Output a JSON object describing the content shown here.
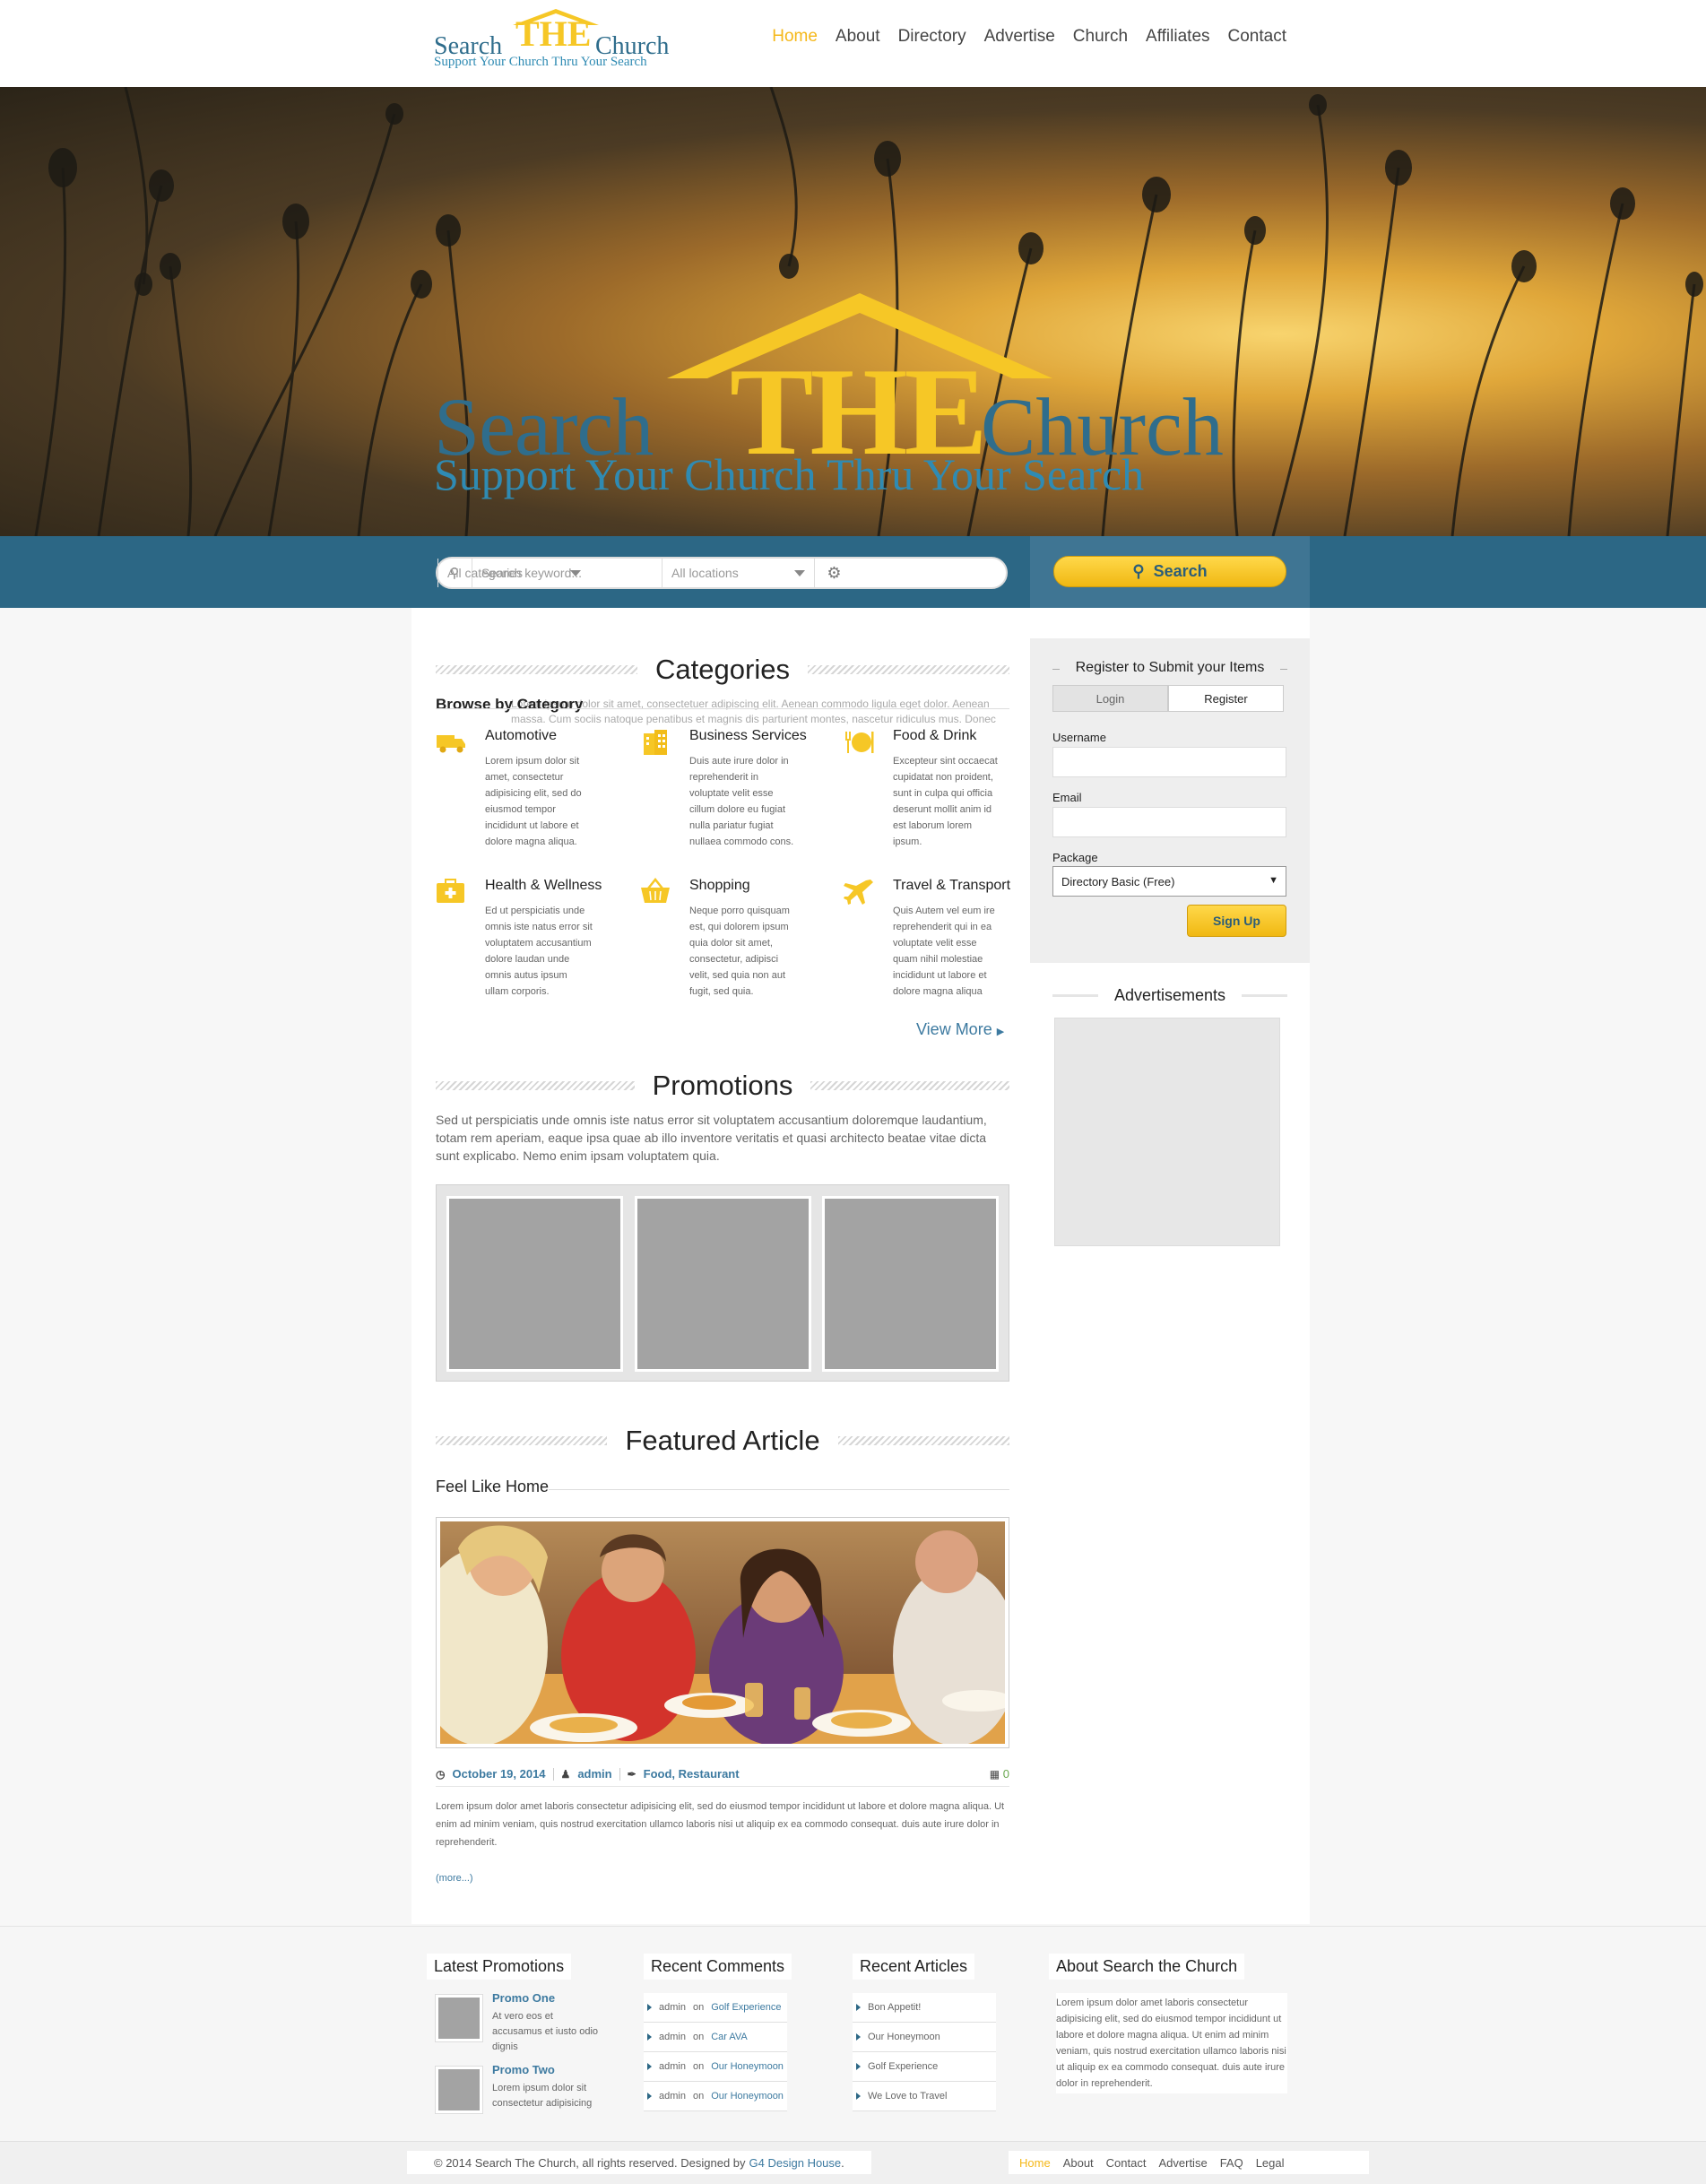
{
  "header": {
    "logo": {
      "search": "Search",
      "the": "THE",
      "church": "Church",
      "tagline": "Support Your Church Thru Your Search"
    },
    "nav": [
      "Home",
      "About",
      "Directory",
      "Advertise",
      "Church",
      "Affiliates",
      "Contact"
    ],
    "active_nav": "Home"
  },
  "hero": {
    "search": "Search",
    "the": "THE",
    "church": "Church",
    "tagline": "Support Your Church Thru Your Search"
  },
  "search": {
    "keyword_placeholder": "Search keyword...",
    "location": "All locations",
    "category": "All categories",
    "button": "Search"
  },
  "categories": {
    "title": "Categories",
    "browse": "Browse by Category",
    "ghost_text": "Lorem ipsum dolor sit amet, consectetuer adipiscing elit. Aenean commodo ligula eget dolor. Aenean massa. Cum sociis natoque penatibus et magnis dis parturient montes, nascetur ridiculus mus. Donec quam felis, ultricies nec.",
    "items": [
      {
        "name": "Automotive",
        "icon": "truck-icon",
        "desc": "Lorem ipsum dolor sit amet, consectetur adipisicing elit, sed do eiusmod tempor incididunt ut labore et dolore magna aliqua."
      },
      {
        "name": "Business Services",
        "icon": "building-icon",
        "desc": "Duis aute irure dolor in reprehenderit in voluptate velit esse cillum dolore eu fugiat nulla pariatur fugiat nullaea commodo cons."
      },
      {
        "name": "Food & Drink",
        "icon": "food-icon",
        "desc": "Excepteur sint occaecat cupidatat non proident, sunt in culpa qui officia deserunt mollit anim id est laborum lorem ipsum."
      },
      {
        "name": "Health & Wellness",
        "icon": "first-aid-icon",
        "desc": "Ed ut perspiciatis unde omnis iste natus error sit voluptatem accusantium dolore laudan unde omnis autus ipsum ullam corporis."
      },
      {
        "name": "Shopping",
        "icon": "basket-icon",
        "desc": "Neque porro quisquam est, qui dolorem ipsum quia dolor sit amet, consectetur, adipisci velit, sed quia non aut fugit, sed quia."
      },
      {
        "name": "Travel &  Transport",
        "icon": "airplane-icon",
        "desc": "Quis Autem vel eum ire reprehenderit qui in ea voluptate velit esse quam nihil molestiae incididunt ut labore et dolore magna aliqua"
      }
    ],
    "view_more": "View More"
  },
  "promotions": {
    "title": "Promotions",
    "text": "Sed ut perspiciatis unde omnis iste natus error sit voluptatem accusantium doloremque laudantium, totam rem aperiam, eaque ipsa quae ab illo inventore veritatis et quasi architecto beatae vitae dicta sunt explicabo. Nemo enim ipsam voluptatem quia."
  },
  "featured": {
    "title": "Featured Article",
    "article_title": "Feel Like Home",
    "date": "October 19, 2014",
    "author": "admin",
    "tags": "Food, Restaurant",
    "comments": "0",
    "body": "Lorem ipsum dolor amet laboris consectetur adipisicing elit, sed do eiusmod tempor incididunt ut labore et dolore magna aliqua. Ut enim ad minim veniam, quis nostrud exercitation ullamco laboris nisi ut aliquip ex ea commodo consequat. duis aute irure dolor in reprehenderit.",
    "more": "(more...)"
  },
  "register": {
    "title": "Register to Submit your Items",
    "tab_login": "Login",
    "tab_register": "Register",
    "username_label": "Username",
    "email_label": "Email",
    "package_label": "Package",
    "package_value": "Directory Basic (Free)",
    "signup": "Sign Up"
  },
  "ads": {
    "title": "Advertisements"
  },
  "footer": {
    "latest_promotions": {
      "title": "Latest Promotions",
      "items": [
        {
          "title": "Promo One",
          "desc": "At vero eos et accusamus et iusto odio dignis"
        },
        {
          "title": "Promo Two",
          "desc": "Lorem ipsum dolor sit consectetur adipisicing"
        }
      ]
    },
    "recent_comments": {
      "title": "Recent Comments",
      "items": [
        {
          "author": "admin",
          "on": "on",
          "post": "Golf Experience"
        },
        {
          "author": "admin",
          "on": "on",
          "post": "Car AVA"
        },
        {
          "author": "admin",
          "on": "on",
          "post": "Our Honeymoon"
        },
        {
          "author": "admin",
          "on": "on",
          "post": "Our Honeymoon"
        }
      ]
    },
    "recent_articles": {
      "title": "Recent Articles",
      "items": [
        "Bon Appetit!",
        "Our Honeymoon",
        "Golf Experience",
        "We Love to Travel"
      ]
    },
    "about": {
      "title": "About Search the Church",
      "text": "Lorem ipsum dolor amet laboris consectetur adipisicing elit, sed do eiusmod tempor incididunt ut labore et dolore magna aliqua. Ut enim ad minim veniam, quis nostrud exercitation ullamco laboris nisi ut aliquip ex ea commodo consequat. duis aute irure dolor in reprehenderit."
    },
    "copyright": "© 2014 Search The Church, all rights reserved. Designed by",
    "designer": "G4 Design House",
    "period": ".",
    "nav": [
      "Home",
      "About",
      "Contact",
      "Advertise",
      "FAQ",
      "Legal"
    ]
  },
  "colors": {
    "brand_blue": "#2c6785",
    "brand_yellow": "#f6c726",
    "link": "#3d7aa0",
    "nav_active": "#f5b81a"
  }
}
